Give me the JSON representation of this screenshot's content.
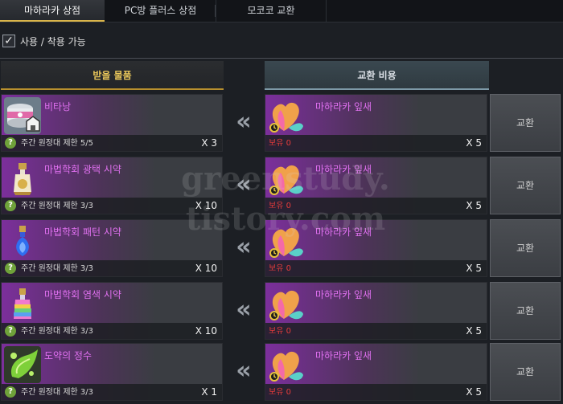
{
  "tabs": [
    {
      "label": "마하라카 상점"
    },
    {
      "label": "PC방 플러스 상점"
    },
    {
      "label": "모코코 교환"
    }
  ],
  "filter": {
    "label": "사용 / 착용 가능",
    "checked": true
  },
  "headers": {
    "receive": "받을 물품",
    "cost": "교환 비용"
  },
  "rows": [
    {
      "item_name": "비타낭",
      "limit": "주간 원정대 제한 5/5",
      "qty": "X 3",
      "cost_name": "마하라카 잎새",
      "owned": "보유 0",
      "cost_qty": "X 5",
      "button": "교환",
      "icon": "pet-food-can-icon"
    },
    {
      "item_name": "마법학회 광택 시약",
      "limit": "주간 원정대 제한 3/3",
      "qty": "X 10",
      "cost_name": "마하라카 잎새",
      "owned": "보유 0",
      "cost_qty": "X 5",
      "button": "교환",
      "icon": "gold-potion-icon"
    },
    {
      "item_name": "마법학회 패턴 시약",
      "limit": "주간 원정대 제한 3/3",
      "qty": "X 10",
      "cost_name": "마하라카 잎새",
      "owned": "보유 0",
      "cost_qty": "X 5",
      "button": "교환",
      "icon": "blue-potion-icon"
    },
    {
      "item_name": "마법학회 염색 시약",
      "limit": "주간 원정대 제한 3/3",
      "qty": "X 10",
      "cost_name": "마하라카 잎새",
      "owned": "보유 0",
      "cost_qty": "X 5",
      "button": "교환",
      "icon": "rainbow-potion-icon"
    },
    {
      "item_name": "도약의 정수",
      "limit": "주간 원정대 제한 3/3",
      "qty": "X 1",
      "cost_name": "마하라카 잎새",
      "owned": "보유 0",
      "cost_qty": "X 5",
      "button": "교환",
      "icon": "green-essence-icon"
    }
  ],
  "watermark": [
    "greenstudy.",
    "tistory.com"
  ]
}
